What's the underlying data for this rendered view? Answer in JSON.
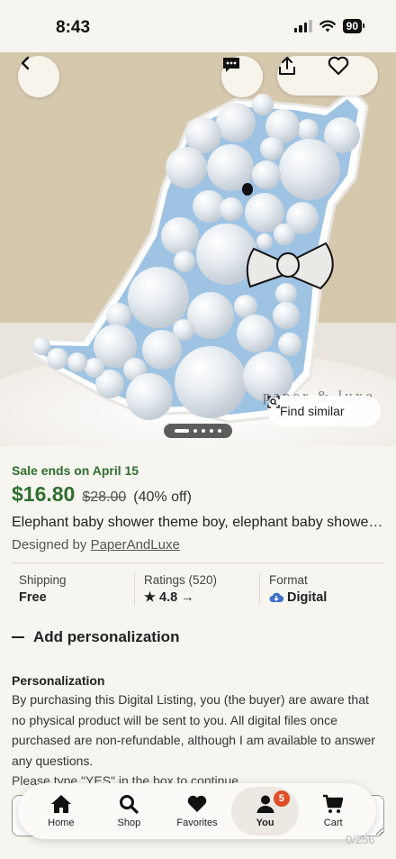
{
  "status": {
    "time": "8:43",
    "battery": "90"
  },
  "hero": {
    "watermark": "paper & luxe",
    "find_similar": "Find similar"
  },
  "listing": {
    "sale_ends": "Sale ends on April 15",
    "price": "$16.80",
    "original_price": "$28.00",
    "discount": "(40% off)",
    "title": "Elephant baby shower theme boy, elephant baby shower decorations",
    "designed_by_prefix": "Designed by",
    "shop_name": "PaperAndLuxe",
    "facts": [
      {
        "label": "Shipping",
        "value": "Free"
      },
      {
        "label": "Ratings (520)",
        "value": "4.8"
      },
      {
        "label": "Format",
        "value": "Digital"
      }
    ]
  },
  "personalization": {
    "toggle_label": "Add personalization",
    "heading": "Personalization",
    "body": "By purchasing this Digital Listing, you (the buyer) are aware that no physical product will be sent to you. All digital files once purchased are non-refundable, although I am available to answer any questions.",
    "prompt": "Please type \"YES\" in the box to continue.",
    "input_value": ""
  },
  "tabbar": {
    "tabs": [
      {
        "label": "Home",
        "icon": "home-icon"
      },
      {
        "label": "Shop",
        "icon": "search-icon"
      },
      {
        "label": "Favorites",
        "icon": "heart-icon"
      },
      {
        "label": "You",
        "icon": "person-icon",
        "badge": "5",
        "active": true
      },
      {
        "label": "Cart",
        "icon": "cart-icon"
      }
    ]
  },
  "pager": "0/256",
  "colors": {
    "accent_green": "#2f6f2f",
    "badge": "#e04e2a",
    "background": "#f6f5ef"
  }
}
